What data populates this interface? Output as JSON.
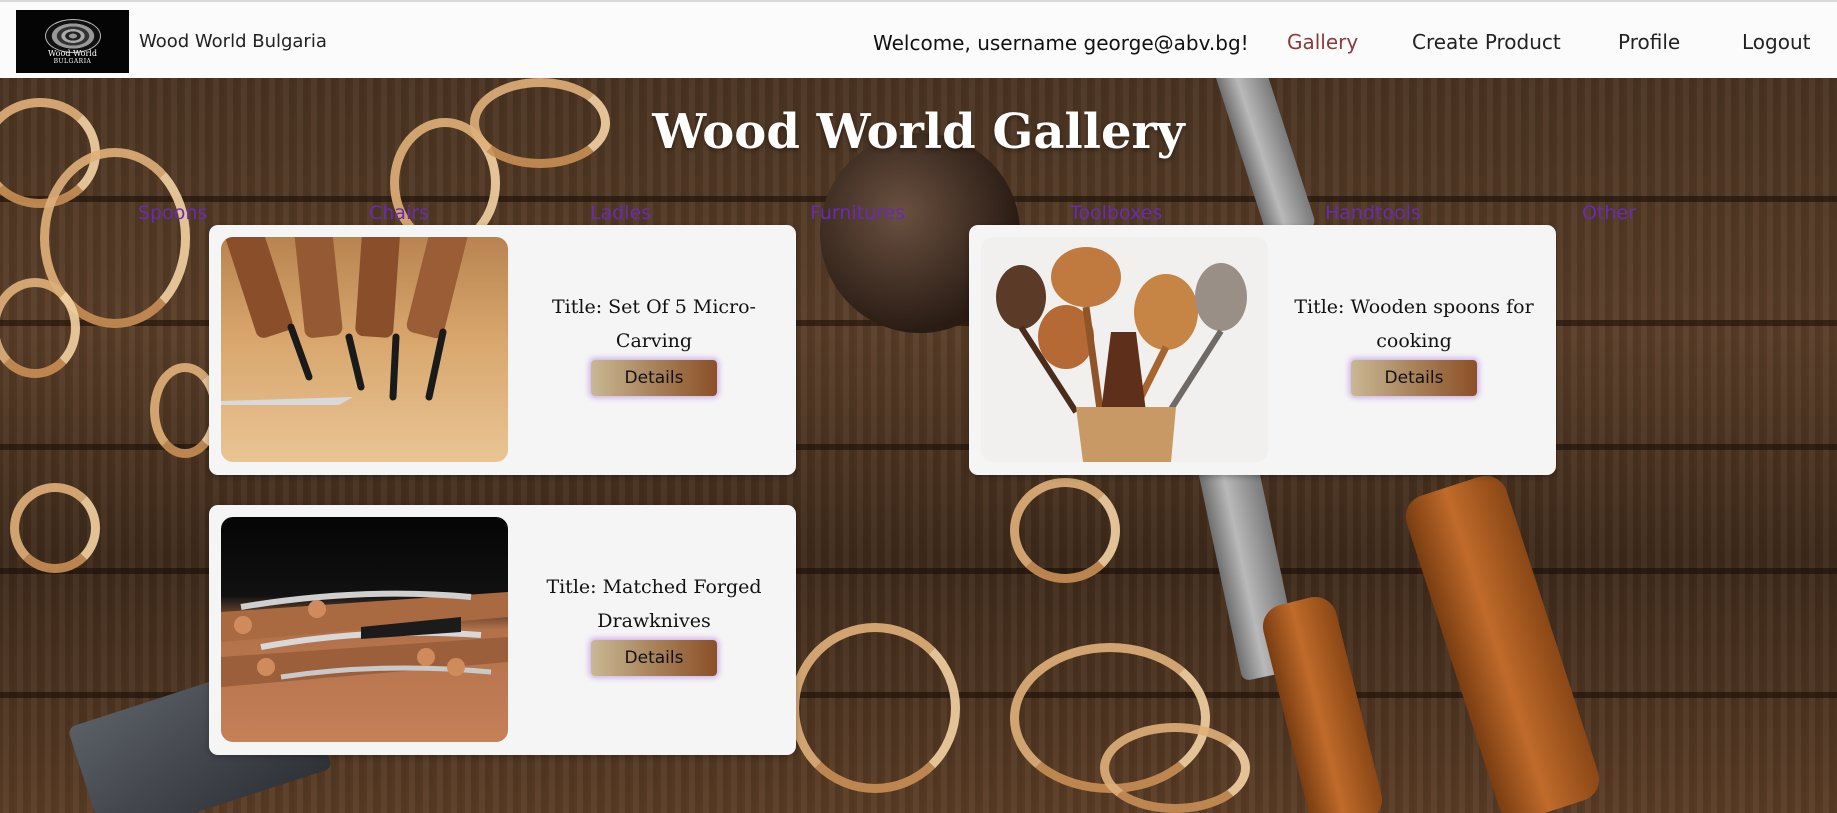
{
  "header": {
    "logo": {
      "line1": "Wood World",
      "line2": "BULGARIA"
    },
    "brand": "Wood World Bulgaria",
    "welcome": "Welcome, username george@abv.bg!",
    "nav": {
      "gallery": "Gallery",
      "create": "Create Product",
      "profile": "Profile",
      "logout": "Logout"
    },
    "colors": {
      "active_link": "#8b3a3a"
    }
  },
  "main": {
    "title": "Wood World Gallery",
    "categories": [
      "Spoons",
      "Chairs",
      "Ladles",
      "Furnitures",
      "Toolboxes",
      "Handtools",
      "Other"
    ],
    "category_color": "#6a2bb0",
    "products": [
      {
        "title": "Title: Set Of 5 Micro-Carving",
        "button": "Details",
        "image": "micro-carving-tools"
      },
      {
        "title": "Title: Wooden spoons for cooking",
        "button": "Details",
        "image": "wooden-spoons"
      },
      {
        "title": "Title: Matched Forged Drawknives",
        "button": "Details",
        "image": "forged-drawknives"
      }
    ]
  }
}
